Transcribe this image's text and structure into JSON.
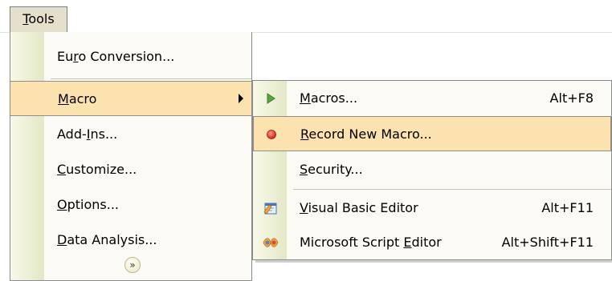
{
  "menubar": {
    "tools": {
      "pre": "",
      "accel": "T",
      "post": "ools"
    }
  },
  "tools_menu": {
    "items": [
      {
        "pre": "Eu",
        "accel": "r",
        "post": "o Conversion..."
      },
      {
        "pre": "",
        "accel": "M",
        "post": "acro"
      },
      {
        "pre": "Add-",
        "accel": "I",
        "post": "ns..."
      },
      {
        "pre": "",
        "accel": "C",
        "post": "ustomize..."
      },
      {
        "pre": "",
        "accel": "O",
        "post": "ptions..."
      },
      {
        "pre": "",
        "accel": "D",
        "post": "ata Analysis..."
      }
    ],
    "expand_glyph": "»"
  },
  "macro_submenu": {
    "items": [
      {
        "pre": "",
        "accel": "M",
        "post": "acros...",
        "shortcut": "Alt+F8",
        "icon": "play-icon"
      },
      {
        "pre": "",
        "accel": "R",
        "post": "ecord New Macro...",
        "shortcut": "",
        "icon": "record-icon"
      },
      {
        "pre": "",
        "accel": "S",
        "post": "ecurity...",
        "shortcut": "",
        "icon": ""
      },
      {
        "pre": "",
        "accel": "V",
        "post": "isual Basic Editor",
        "shortcut": "Alt+F11",
        "icon": "visual-basic-icon"
      },
      {
        "pre": "Microsoft Script ",
        "accel": "E",
        "post": "ditor",
        "shortcut": "Alt+Shift+F11",
        "icon": "script-editor-icon"
      }
    ]
  },
  "colors": {
    "highlight": "#fbe2ae",
    "menubar_active": "#e5e0cc",
    "icon_strip": "#e3e8c6",
    "record_dot": "#e0392b",
    "play_triangle": "#5aa542"
  }
}
